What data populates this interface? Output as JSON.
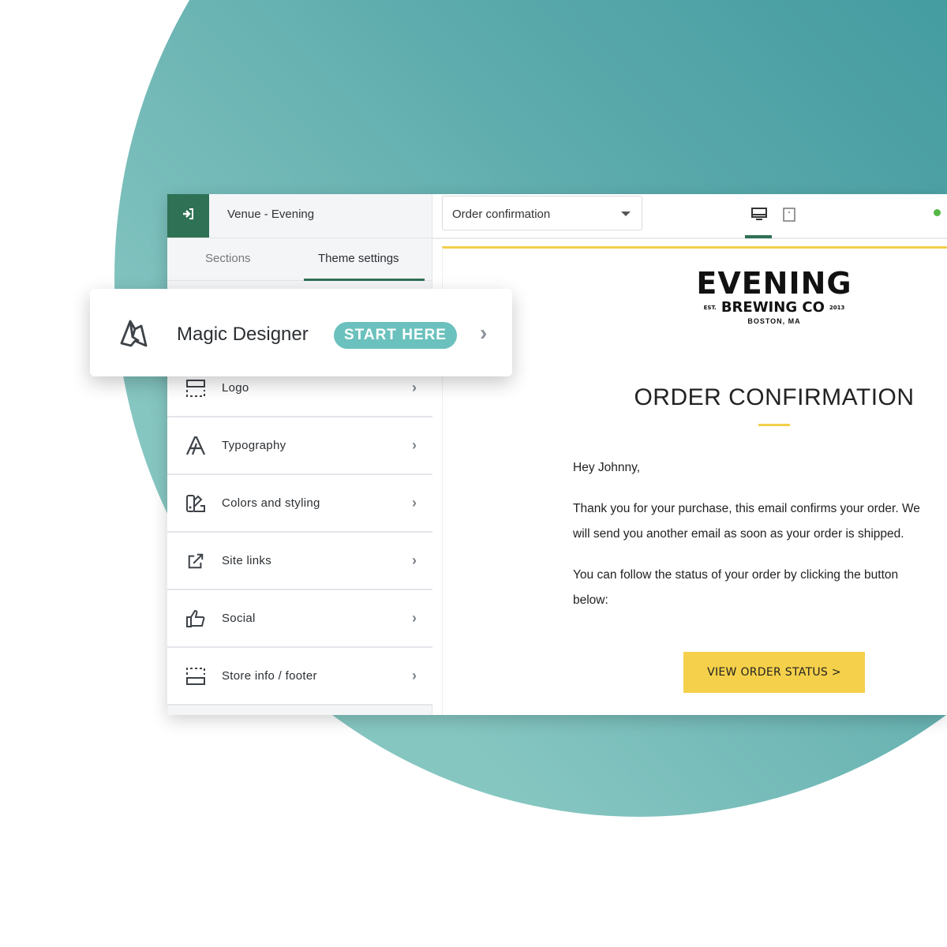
{
  "sidebar": {
    "theme_name": "Venue - Evening",
    "tabs": [
      {
        "label": "Sections"
      },
      {
        "label": "Theme settings",
        "active": true
      }
    ],
    "items": [
      {
        "label": "Logo",
        "icon": "logo-layout-icon"
      },
      {
        "label": "Typography",
        "icon": "typography-icon"
      },
      {
        "label": "Colors and styling",
        "icon": "palette-icon"
      },
      {
        "label": "Site links",
        "icon": "external-link-icon"
      },
      {
        "label": "Social",
        "icon": "thumbs-up-icon"
      },
      {
        "label": "Store info / footer",
        "icon": "footer-layout-icon"
      }
    ]
  },
  "magic": {
    "title": "Magic Designer",
    "badge": "START HERE"
  },
  "toolbar": {
    "template_select": "Order confirmation",
    "status_color": "#55b848"
  },
  "email": {
    "logo": {
      "main": "EVENING",
      "sub": "BREWING CO",
      "est": "EST.",
      "year": "2013",
      "city": "BOSTON, MA"
    },
    "heading": "ORDER CONFIRMATION",
    "greeting": "Hey Johnny,",
    "para1": "Thank you for your purchase, this email confirms your order. We will send you another email as soon as your order is shipped.",
    "para2": "You can follow the status of your order by clicking the button below:",
    "cta": "VIEW ORDER STATUS >"
  },
  "colors": {
    "brand_green": "#2e7155",
    "teal": "#6bc1bd",
    "accent_yellow": "#f5d04a"
  }
}
